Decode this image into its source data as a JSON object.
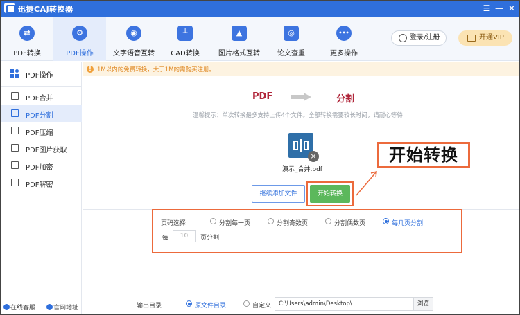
{
  "app": {
    "title": "迅捷CAJ转换器"
  },
  "window_controls": {
    "menu": "☰",
    "minimize": "—",
    "close": "✕"
  },
  "toolbar": {
    "tabs": [
      {
        "label": "PDF转换",
        "glyph": "⇄",
        "icon": "pdf-convert-icon"
      },
      {
        "label": "PDF操作",
        "glyph": "⚙",
        "icon": "gear-icon",
        "active": true
      },
      {
        "label": "文字语音互转",
        "glyph": "◉",
        "icon": "speech-icon"
      },
      {
        "label": "CAD转换",
        "glyph": "┴",
        "icon": "cad-icon"
      },
      {
        "label": "图片格式互转",
        "glyph": "▲",
        "icon": "image-icon"
      },
      {
        "label": "论文查重",
        "glyph": "◎",
        "icon": "search-icon"
      },
      {
        "label": "更多操作",
        "glyph": "•••",
        "icon": "more-icon"
      }
    ],
    "login_label": "登录/注册",
    "vip_label": "开通VIP"
  },
  "sidebar": {
    "header": "PDF操作",
    "items": [
      {
        "label": "PDF合并",
        "icon": "merge-icon"
      },
      {
        "label": "PDF分割",
        "icon": "split-icon",
        "active": true
      },
      {
        "label": "PDF压缩",
        "icon": "compress-icon"
      },
      {
        "label": "PDF图片获取",
        "icon": "image-extract-icon"
      },
      {
        "label": "PDF加密",
        "icon": "lock-icon"
      },
      {
        "label": "PDF解密",
        "icon": "unlock-icon"
      }
    ],
    "footer": {
      "support": "在线客服",
      "website": "官网地址"
    }
  },
  "notice": {
    "text": "1M以内的免费转换，大于1M的需购买注册。"
  },
  "flow": {
    "from": "PDF",
    "to": "分割"
  },
  "tip": "温馨提示：单次转换最多支持上传4个文件。全部转换需要较长时间，请耐心等待",
  "file": {
    "name": "演示_合并.pdf",
    "delete_glyph": "×"
  },
  "buttons": {
    "add_files": "继续添加文件",
    "start": "开始转换"
  },
  "callout": "开始转换",
  "page_options": {
    "label": "页码选择",
    "options": [
      {
        "label": "分割每一页",
        "selected": false
      },
      {
        "label": "分割奇数页",
        "selected": false
      },
      {
        "label": "分割偶数页",
        "selected": false
      },
      {
        "label": "每几页分割",
        "selected": true
      }
    ],
    "every_prefix": "每",
    "every_value": "10",
    "every_suffix": "页分割"
  },
  "output": {
    "label": "输出目录",
    "options": [
      {
        "label": "原文件目录",
        "selected": true
      },
      {
        "label": "自定义",
        "selected": false
      }
    ],
    "path": "C:\\Users\\admin\\Desktop\\",
    "browse_label": "浏览"
  },
  "colors": {
    "brand_blue": "#2f6fdc",
    "highlight_orange": "#ec6a3c",
    "start_green": "#5cb85c",
    "title_red": "#b0263a"
  }
}
